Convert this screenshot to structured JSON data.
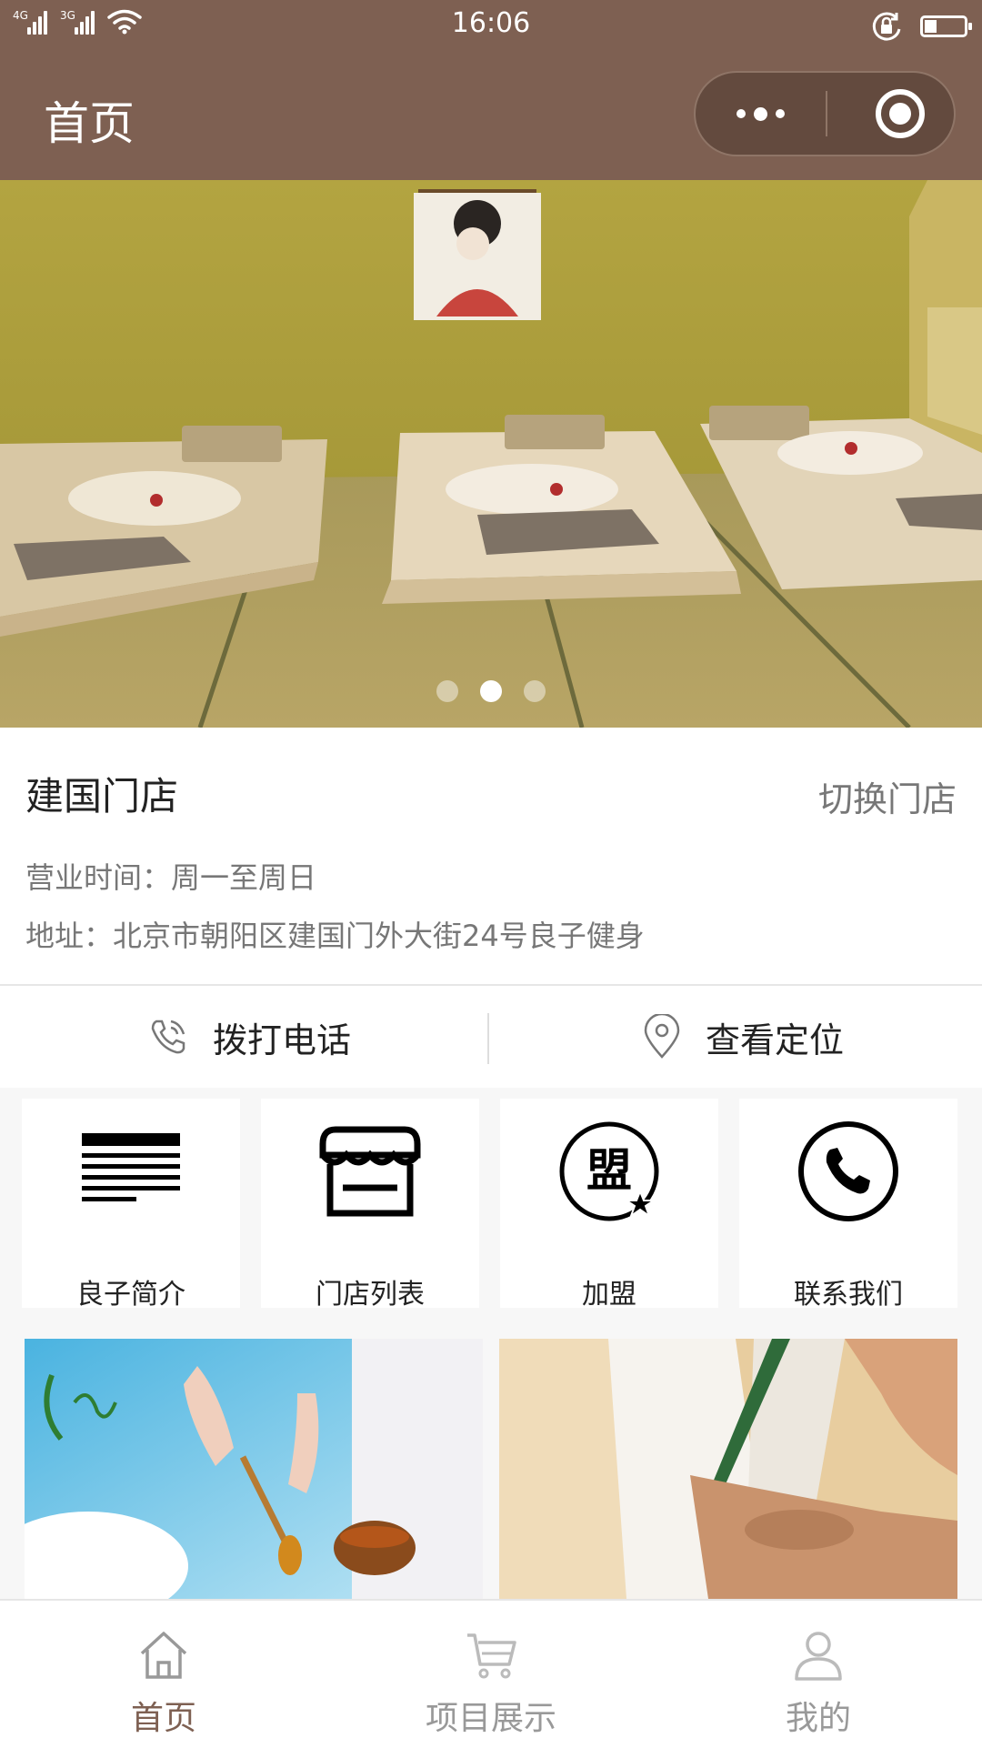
{
  "status_bar": {
    "network_1": "4G",
    "network_2": "3G",
    "time": "16:06",
    "icons": [
      "signal-icon",
      "wifi-icon",
      "rotation-lock-icon",
      "battery-icon"
    ],
    "battery_level": 0.3
  },
  "nav": {
    "title": "首页",
    "menu_icon": "more-dots-icon",
    "close_icon": "target-circle-icon",
    "bg_color": "#7e6052"
  },
  "banner": {
    "slide_count": 3,
    "active_slide": 2
  },
  "store": {
    "name": "建国门店",
    "switch_label": "切换门店",
    "hours": "营业时间：周一至周日",
    "address": "地址：北京市朝阳区建国门外大街24号良子健身"
  },
  "actions": {
    "call_label": "拨打电话",
    "locate_label": "查看定位"
  },
  "menu_grid": [
    {
      "label": "良子简介",
      "icon": "document-lines-icon"
    },
    {
      "label": "门店列表",
      "icon": "storefront-icon"
    },
    {
      "label": "加盟",
      "icon": "franchise-badge-icon",
      "icon_text": "盟"
    },
    {
      "label": "联系我们",
      "icon": "phone-circle-icon"
    }
  ],
  "tab_bar": {
    "items": [
      {
        "label": "首页",
        "icon": "home-icon",
        "active": true
      },
      {
        "label": "项目展示",
        "icon": "cart-icon",
        "active": false
      },
      {
        "label": "我的",
        "icon": "user-icon",
        "active": false
      }
    ],
    "active_color": "#7e6052",
    "inactive_color": "#999999"
  }
}
